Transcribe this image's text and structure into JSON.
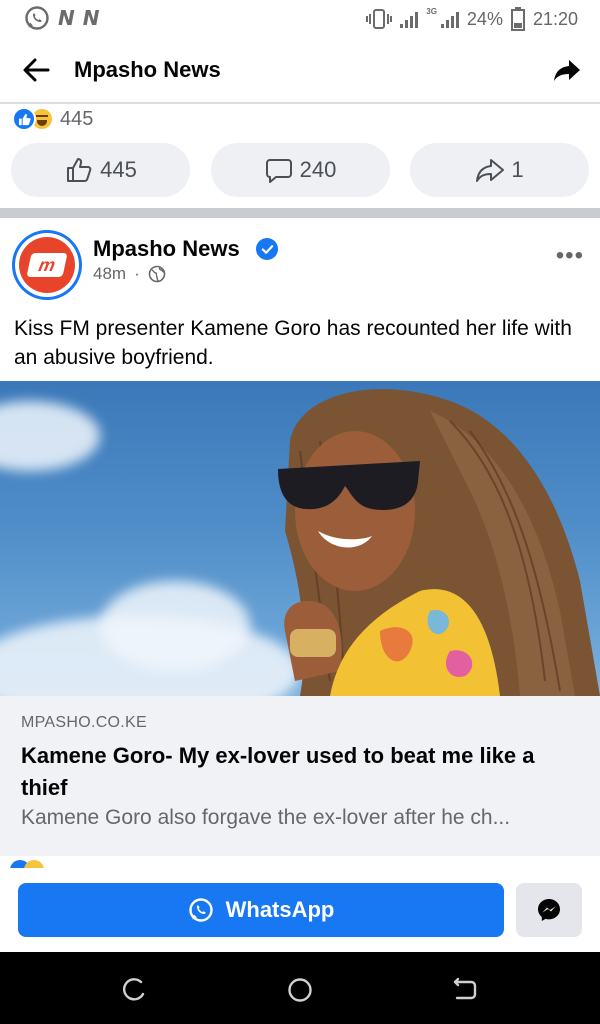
{
  "status_bar": {
    "left_icons": [
      "whatsapp-icon",
      "n-notification-icon",
      "n-notification-icon"
    ],
    "n_label_1": "N",
    "n_label_2": "N",
    "network_label": "3G",
    "battery": "24%",
    "time": "21:20"
  },
  "header": {
    "title": "Mpasho News",
    "back_icon": "arrow-left-icon",
    "share_icon": "share-arrow-icon"
  },
  "previous_post": {
    "reaction_icons": [
      "like-icon",
      "haha-icon"
    ],
    "reaction_count": "445",
    "like_count": "445",
    "comment_count": "240",
    "share_count": "1"
  },
  "post": {
    "author": "Mpasho News",
    "avatar_letter": "m",
    "verified": true,
    "time": "48m",
    "separator": "·",
    "audience_icon": "globe-icon",
    "more": "•••",
    "text": "Kiss FM presenter Kamene Goro has recounted her life with an abusive boyfriend.",
    "link": {
      "domain": "MPASHO.CO.KE",
      "title": "Kamene Goro- My ex-lover used to beat me like a thief",
      "description": "Kamene Goro also forgave the ex-lover after he ch..."
    }
  },
  "actions": {
    "whatsapp_label": "WhatsApp",
    "messenger_icon": "messenger-icon"
  },
  "nav": {
    "buttons": [
      "recent-apps-icon",
      "home-icon",
      "back-icon"
    ]
  },
  "colors": {
    "facebook_blue": "#1877f2",
    "pill_bg": "#eef0f3",
    "preview_bg": "#f0f2f5",
    "mpasho_red": "#e8442b"
  }
}
